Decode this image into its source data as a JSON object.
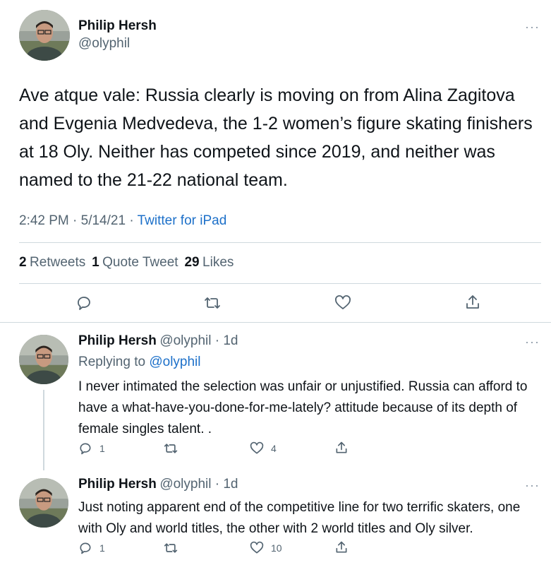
{
  "main_tweet": {
    "name": "Philip Hersh",
    "handle": "@olyphil",
    "text": "Ave atque vale:  Russia clearly is moving on from Alina Zagitova and Evgenia Medvedeva, the 1-2 women’s figure skating finishers at 18 Oly.  Neither has competed since 2019, and neither was named to the 21-22 national team.",
    "time": "2:42 PM · 5/14/21 · ",
    "source": "Twitter for iPad",
    "retweets_count": "2",
    "retweets_label": "Retweets",
    "quote_count": "1",
    "quote_label": "Quote Tweet",
    "likes_count": "29",
    "likes_label": "Likes"
  },
  "replies": [
    {
      "name": "Philip Hersh",
      "handle": "@olyphil · 1d",
      "replying_prefix": "Replying to ",
      "replying_handle": "@olyphil",
      "text": "I never intimated the selection was unfair or unjustified.  Russia can afford to have a what-have-you-done-for-me-lately? attitude because of its depth of female singles talent.  .",
      "reply_count": "1",
      "like_count": "4"
    },
    {
      "name": "Philip Hersh",
      "handle": "@olyphil · 1d",
      "text": "Just noting apparent end of the competitive line for two terrific skaters, one with Oly and world titles, the other with 2 world titles and Oly silver.",
      "reply_count": "1",
      "like_count": "10"
    }
  ],
  "more_glyph": "···",
  "colors": {
    "link": "#1d70c9",
    "secondary": "#536471",
    "divider": "#cfd9de"
  }
}
